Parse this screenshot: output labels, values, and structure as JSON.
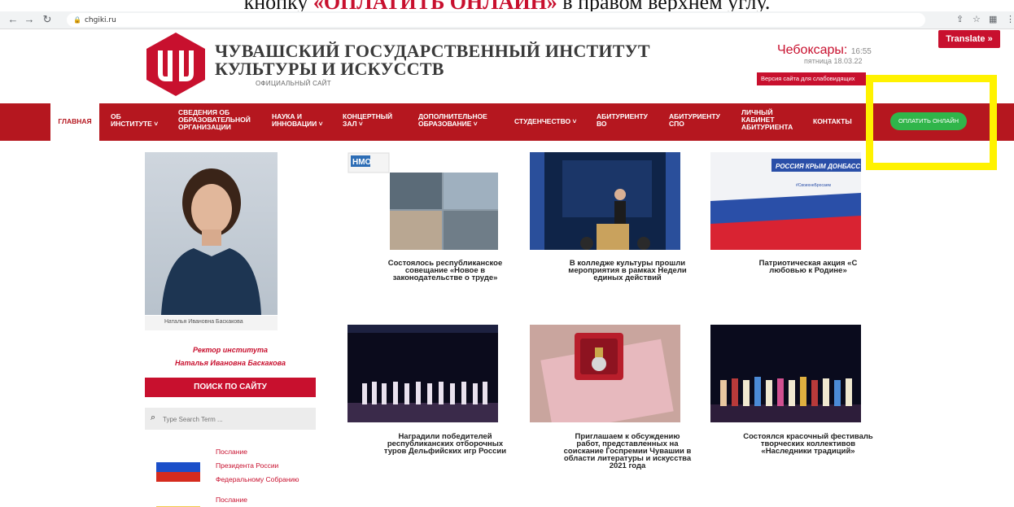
{
  "caption": {
    "before": "кнопку ",
    "highlight": "«ОПЛАТИТЬ ОНЛАЙН»",
    "after": " в правом верхнем углу."
  },
  "browser": {
    "url": "chgiki.ru"
  },
  "header": {
    "title_line1": "ЧУВАШСКИЙ ГОСУДАРСТВЕННЫЙ ИНСТИТУТ",
    "title_line2": "КУЛЬТУРЫ И ИСКУССТВ",
    "subtitle": "ОФИЦИАЛЬНЫЙ САЙТ",
    "city": "Чебоксары:",
    "time": "16:55",
    "date": "пятница 18.03.22",
    "vision_button": "Версия сайта для слабовидящих",
    "translate_button": "Translate »"
  },
  "nav": {
    "items": [
      {
        "label": "ГЛАВНАЯ"
      },
      {
        "label": "ОБ ИНСТИТУТЕ"
      },
      {
        "label": "СВЕДЕНИЯ ОБ ОБРАЗОВАТЕЛЬНОЙ ОРГАНИЗАЦИИ"
      },
      {
        "label": "НАУКА И ИННОВАЦИИ"
      },
      {
        "label": "КОНЦЕРТНЫЙ ЗАЛ"
      },
      {
        "label": "ДОПОЛНИТЕЛЬНОЕ ОБРАЗОВАНИЕ"
      },
      {
        "label": "СТУДЕНЧЕСТВО"
      },
      {
        "label": "АБИТУРИЕНТУ ВО"
      },
      {
        "label": "АБИТУРИЕНТУ СПО"
      },
      {
        "label": "ЛИЧНЫЙ КАБИНЕТ АБИТУРИЕНТА"
      },
      {
        "label": "КОНТАКТЫ"
      }
    ],
    "pay_button": "ОПЛАТИТЬ ОНЛАЙН"
  },
  "sidebar": {
    "photo_caption": "Наталья Ивановна Баскакова",
    "rector_role": "Ректор института",
    "rector_name": "Наталья Ивановна Баскакова",
    "search_heading": "ПОИСК ПО САЙТУ",
    "search_placeholder": "Type Search Term ...",
    "message1_line1": "Послание",
    "message1_line2": "Президента России",
    "message1_line3": "Федеральному Собранию",
    "message2_line1": "Послание"
  },
  "news": [
    {
      "title": "Состоялось республиканское совещание «Новое в законодательстве о труде»",
      "badge": "НМО"
    },
    {
      "title": "В колледже культуры прошли мероприятия в рамках Недели единых действий"
    },
    {
      "title": "Патриотическая акция «С любовью к Родине»",
      "banner": "РОССИЯ КРЫМ ДОНБАСС",
      "hashtag": "#СвоихнеБросаем"
    },
    {
      "title": "Наградили победителей республиканских отборочных туров Дельфийских игр России"
    },
    {
      "title": "Приглашаем к обсуждению работ, представленных на соискание Госпремии Чувашии в области литературы и искусства 2021 года"
    },
    {
      "title": "Состоялся красочный фестиваль творческих коллективов «Наследники традиций»"
    }
  ],
  "colors": {
    "brand_red": "#c8102e",
    "nav_red": "#b5171f",
    "pay_green": "#30b54a",
    "highlight_yellow": "#fff200"
  }
}
